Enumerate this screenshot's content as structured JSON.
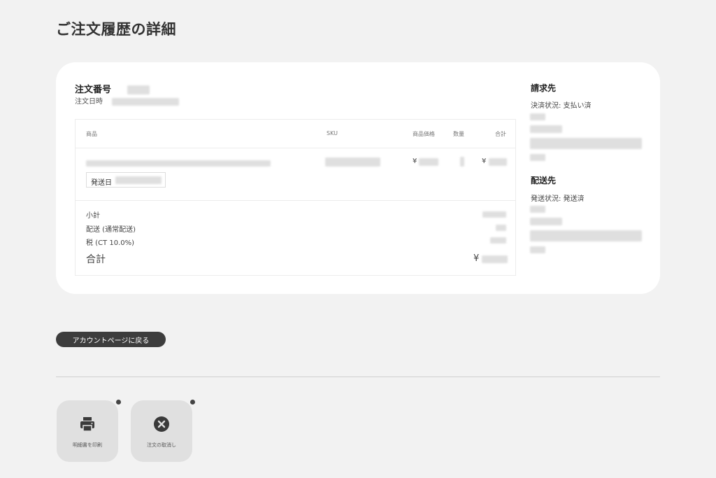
{
  "page_title": "ご注文履歴の詳細",
  "order": {
    "number_label": "注文番号",
    "date_label": "注文日時"
  },
  "table": {
    "headers": {
      "product": "商品",
      "sku": "SKU",
      "price": "商品価格",
      "qty": "数量",
      "total": "合計"
    },
    "row": {
      "price_symbol": "¥",
      "total_symbol": "¥",
      "ship_date_label": "発送日"
    },
    "summary": {
      "subtotal_label": "小計",
      "shipping_label": "配送 (通常配送)",
      "tax_label": "税 (CT 10.0%)",
      "total_label": "合計",
      "total_symbol": "¥"
    }
  },
  "billing": {
    "title": "請求先",
    "status": "決済状況: 支払い済"
  },
  "shipping": {
    "title": "配送先",
    "status": "発送状況: 発送済"
  },
  "back_button": "アカウントページに戻る",
  "actions": [
    {
      "label": "明細書を印刷",
      "icon": "printer-icon"
    },
    {
      "label": "注文の取消し",
      "icon": "close-circle-icon"
    }
  ]
}
